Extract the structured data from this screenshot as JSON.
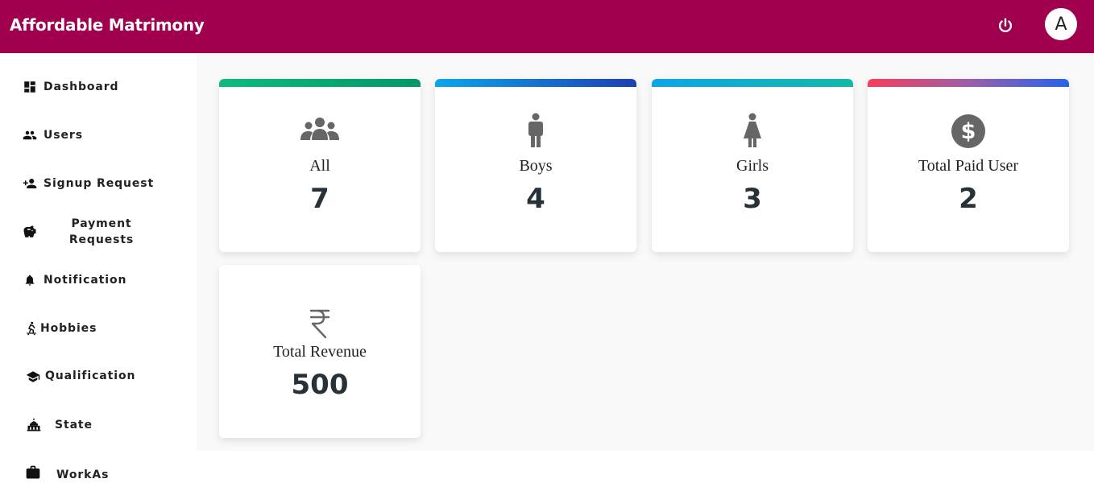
{
  "app": {
    "title": "Affordable Matrimony",
    "avatar_letter": "A"
  },
  "icons": {
    "power": "power-icon",
    "avatar": "avatar"
  },
  "sidebar": {
    "items": [
      {
        "label": "Dashboard",
        "icon": "dashboard-icon"
      },
      {
        "label": "Users",
        "icon": "users-icon"
      },
      {
        "label": "Signup Request",
        "icon": "person-add-icon"
      },
      {
        "label": "Payment Requests",
        "label_line1": "Payment",
        "label_line2": "Requests",
        "icon": "piggy-bank-icon"
      },
      {
        "label": "Notification",
        "icon": "bell-icon"
      },
      {
        "label": "Hobbies",
        "icon": "skateboarding-icon"
      },
      {
        "label": "Qualification",
        "icon": "graduation-cap-icon"
      },
      {
        "label": "State",
        "icon": "government-building-icon"
      },
      {
        "label": "WorkAs",
        "icon": "briefcase-icon"
      }
    ]
  },
  "cards": [
    {
      "label": "All",
      "value": "7",
      "icon": "group-icon",
      "accent": [
        "#10b981",
        "#059669"
      ]
    },
    {
      "label": "Boys",
      "value": "4",
      "icon": "man-icon",
      "accent": [
        "#0ea5e9",
        "#1e40af"
      ]
    },
    {
      "label": "Girls",
      "value": "3",
      "icon": "woman-icon",
      "accent": [
        "#0ea5e9",
        "#14b8a6"
      ]
    },
    {
      "label": "Total Paid User",
      "value": "2",
      "icon": "dollar-icon",
      "accent": [
        "#f43f5e",
        "#2563eb"
      ]
    },
    {
      "label": "Total Revenue",
      "value": "500",
      "icon": "rupee-icon",
      "accent": []
    }
  ],
  "colors": {
    "header": "#a1004f",
    "icon_gray": "#666666",
    "value_text": "#263238"
  }
}
